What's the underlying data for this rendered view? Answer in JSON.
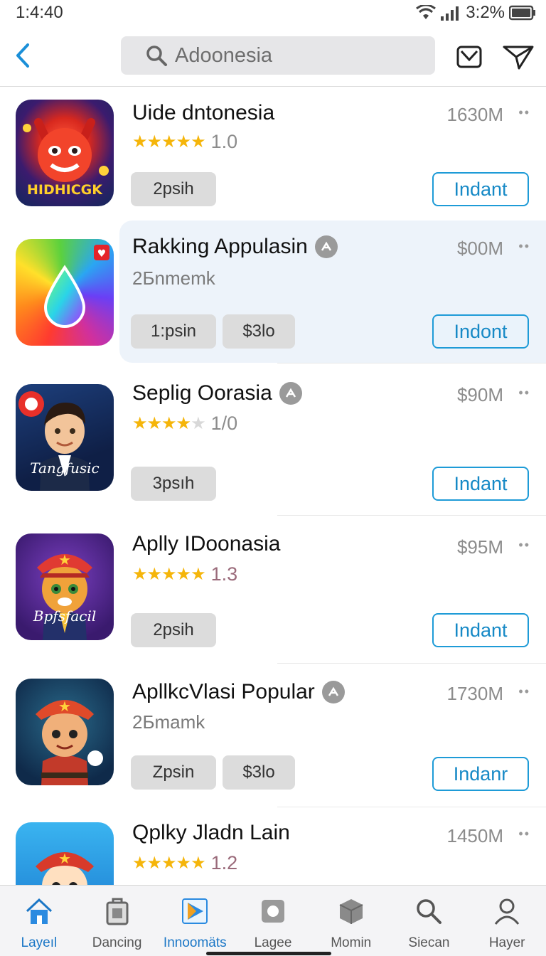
{
  "status_bar": {
    "time": "1:4:40",
    "battery_text": "3:2%"
  },
  "search": {
    "query": "Adoonesia"
  },
  "apps": [
    {
      "name": "Uide dntonesia",
      "size": "1630M",
      "rating": "1.0",
      "stars": 5,
      "subtitle": "",
      "chips": [
        "2psih"
      ],
      "install_label": "Indant",
      "icon_caption": "HIDHICGK",
      "verified": false
    },
    {
      "name": "Rakking Appulasin",
      "size": "$00M",
      "rating": "",
      "stars": 0,
      "subtitle": "2Бnmemk",
      "chips": [
        "1:psin",
        "$3lo"
      ],
      "install_label": "Indont",
      "icon_caption": "",
      "verified": true
    },
    {
      "name": "Seplig Oorasia",
      "size": "$90M",
      "rating": "1/0",
      "stars": 4,
      "subtitle": "",
      "chips": [
        "3psıh"
      ],
      "install_label": "Indant",
      "icon_caption": "Tangfusic",
      "verified": true
    },
    {
      "name": "Aplly IDoonasia",
      "size": "$95M",
      "rating": "1.3",
      "stars": 5,
      "subtitle": "",
      "chips": [
        "2psih"
      ],
      "install_label": "Indant",
      "icon_caption": "Bpfsfacil",
      "verified": false
    },
    {
      "name": "ApllkcVlasi Popular",
      "size": "1730M",
      "rating": "",
      "stars": 0,
      "subtitle": "2Бmamk",
      "chips": [
        "Zpsin",
        "$3lo"
      ],
      "install_label": "Indanr",
      "icon_caption": "",
      "verified": true
    },
    {
      "name": "Qplky Jladn Lain",
      "size": "1450M",
      "rating": "1.2",
      "stars": 5,
      "subtitle": "",
      "chips": [],
      "install_label": "",
      "icon_caption": "",
      "verified": false
    }
  ],
  "more_label": "••",
  "bottom_nav": [
    {
      "label": "Layeıl",
      "icon": "home-icon",
      "active": true
    },
    {
      "label": "Dancing",
      "icon": "bag-icon",
      "active": false
    },
    {
      "label": "Innoomäts",
      "icon": "play-store-icon",
      "active": true
    },
    {
      "label": "Lagee",
      "icon": "tile-icon",
      "active": false
    },
    {
      "label": "Momin",
      "icon": "box-icon",
      "active": false
    },
    {
      "label": "Siecan",
      "icon": "search-icon",
      "active": false
    },
    {
      "label": "Hayer",
      "icon": "user-icon",
      "active": false
    }
  ],
  "colors": {
    "accent": "#1e9bd7",
    "star": "#f5b50a",
    "highlight": "#edf3fa"
  }
}
